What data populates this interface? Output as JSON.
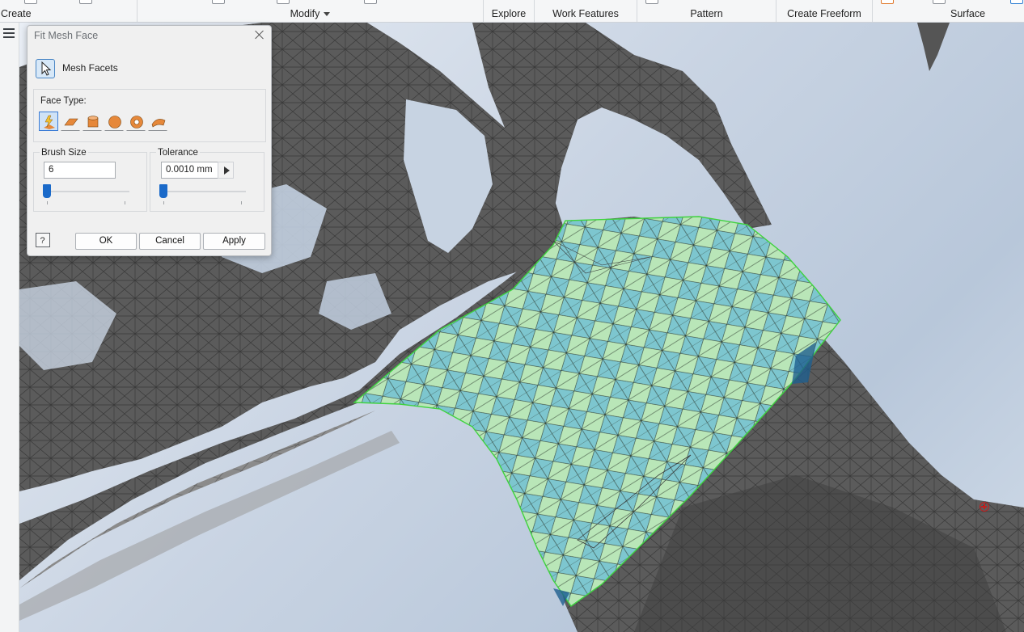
{
  "ribbon": {
    "groups": [
      {
        "label": "Create"
      },
      {
        "label": "Modify"
      },
      {
        "label": "Explore"
      },
      {
        "label": "Work Features"
      },
      {
        "label": "Pattern"
      },
      {
        "label": "Create Freeform"
      },
      {
        "label": "Surface"
      }
    ]
  },
  "dialog": {
    "title": "Fit Mesh Face",
    "selection_label": "Mesh Facets",
    "face_type_label": "Face Type:",
    "face_types": [
      "automatic-icon",
      "plane-icon",
      "cylinder-icon",
      "sphere-icon",
      "torus-icon",
      "freeform-icon"
    ],
    "brush_size": {
      "label": "Brush Size",
      "value": "6",
      "slider_fraction": 0.0
    },
    "tolerance": {
      "label": "Tolerance",
      "value": "0.0010 mm",
      "slider_fraction": 0.0
    },
    "buttons": {
      "ok": "OK",
      "cancel": "Cancel",
      "apply": "Apply"
    },
    "help_icon": "help-icon"
  },
  "colors": {
    "accent": "#1b6ac9",
    "fit_face_fill_a": "#b9e6b8",
    "fit_face_fill_b": "#7dc6cf",
    "fit_face_edge": "#3fd23f",
    "mesh_gray": "#5a5a5a"
  }
}
